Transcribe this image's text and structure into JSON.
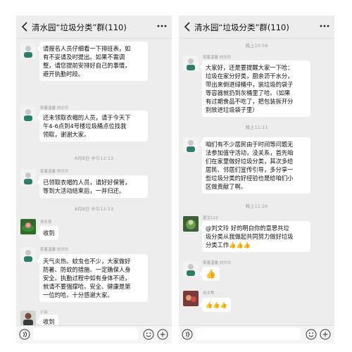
{
  "left_panel": {
    "title": "清水园“垃圾分类”群(110)",
    "messages": [
      {
        "sender": "",
        "lines": [
          "请报名人员仔细看一下排班表，如",
          "有不妥请及时提出。如果不需调",
          "整，请您提前安排好自己的事情，",
          "避开执勤时段。"
        ]
      },
      {
        "sender": "笑着溫馨·刘文玲",
        "lines": [
          "还未领取衣帽的人员，请于今天下",
          "午4-6点到4号楼垃圾桶点位找我",
          "领取，谢谢大家。"
        ]
      },
      {
        "time": "8月8日 中午12:13"
      },
      {
        "sender": "笑着溫馨·刘文玲",
        "lines": [
          "已领取衣帽的人员，请好好保管，",
          "等到大活动结束后，一并归还。"
        ]
      },
      {
        "time": "8月8日 中午12:13"
      },
      {
        "sender": "吴长青",
        "lines": [
          "收到"
        ]
      },
      {
        "sender": "笑着溫馨·刘文玲",
        "lines": [
          "天气炎热、蚊虫也不少，大家做好",
          "防暑、防蚊的措施。一定确保人身",
          "安全。执勤过程中如有身体不适，",
          "就请不要强撑哈。安全、健康是第",
          "一位的哈。十分感谢大家。"
        ]
      },
      {
        "sender": "小女",
        "lines": [
          "收到"
        ]
      }
    ]
  },
  "right_panel": {
    "title": "清水园“垃圾分类”群(110)",
    "messages": [
      {
        "time": "晚上10:58"
      },
      {
        "sender": "笑着溫馨·刘文玲",
        "lines": [
          "大家好，还是要提醒大家一下哈：",
          "垃圾在家分好类，厨余沥干水分，",
          "带出来倒进绿桶中，装垃圾的袋子",
          "等容器就扔到灰桶里了哈。（如果",
          "有过期食品不吃了，把包装拆开分",
          "别放进垃圾袋子里）"
        ]
      },
      {
        "time": "晚上11:11"
      },
      {
        "sender": "笑着溫馨·刘文玲",
        "lines": [
          "咱们有不少居民由于时间等问题无",
          "法参加值守活动，没关系，首先咱",
          "们在家里做好垃圾分类，其次多给",
          "居民、邻居们宣传引导，多分享一",
          "些垃圾分类的好经验也是给咱们小",
          "区做贡献了啊。"
        ]
      },
      {
        "time": "晚上11:26"
      },
      {
        "sender": "夏生123",
        "lines": [
          "@刘文玲  好的明白你的意思共垃",
          "圾分类从我做起共同努力做好垃圾",
          "分类工作👍👍👍"
        ]
      },
      {
        "sender": "笑着溫馨·刘文玲",
        "lines": [
          "👍"
        ]
      },
      {
        "sender": "何文秀",
        "lines": [
          "👍👍👍"
        ]
      }
    ]
  },
  "colors": {
    "panel_bg": "#ededed",
    "bubble_bg": "#ffffff"
  },
  "icons": [
    "back-icon",
    "more-icon",
    "voice-icon",
    "emoji-icon",
    "plus-icon"
  ]
}
